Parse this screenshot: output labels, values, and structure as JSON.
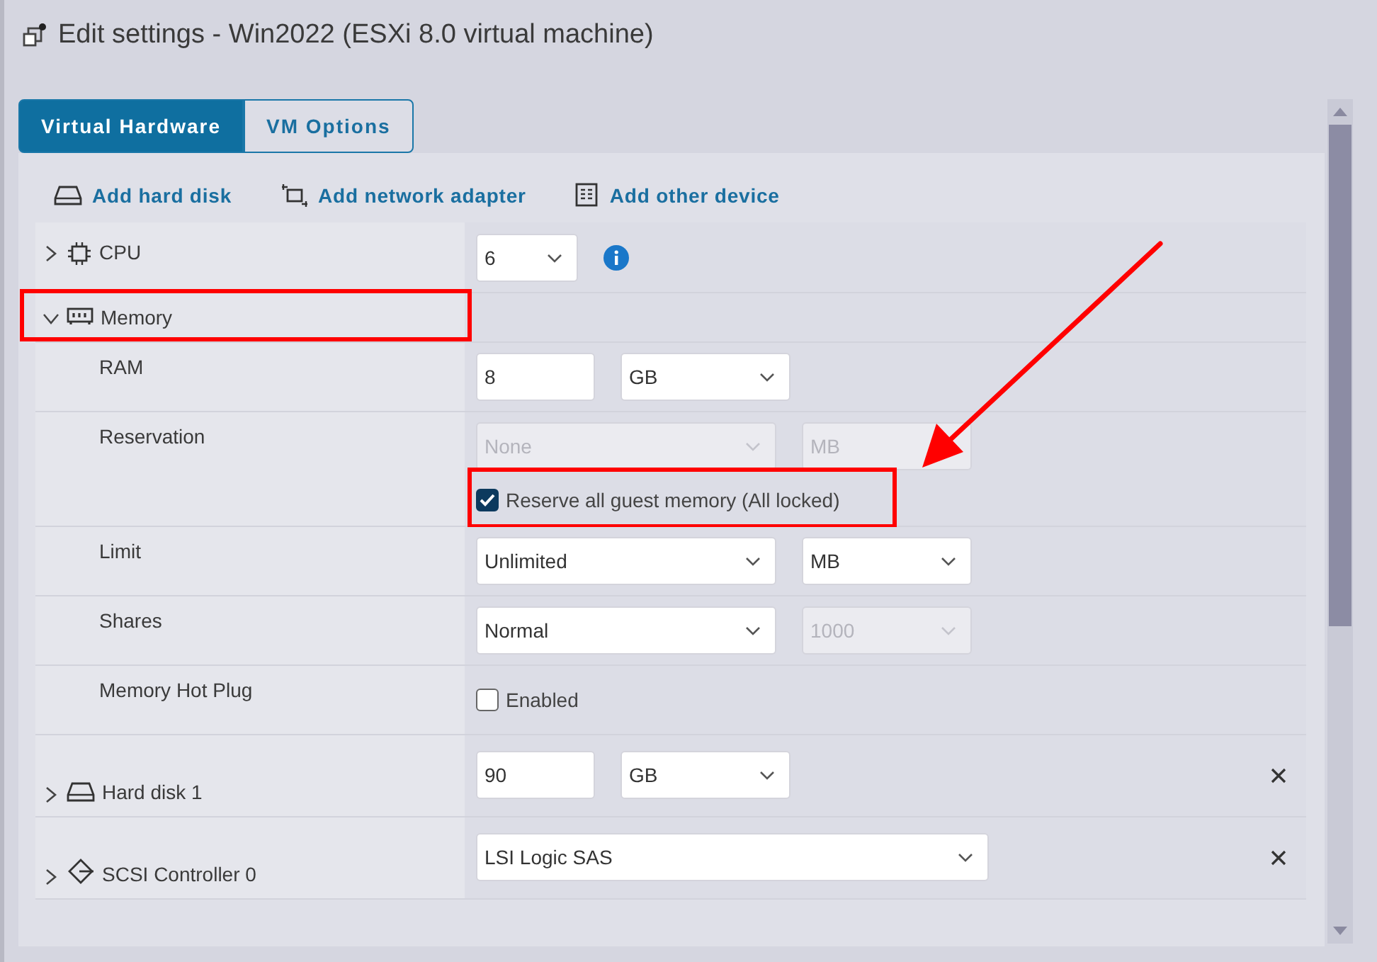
{
  "window": {
    "title": "Edit settings - Win2022 (ESXi 8.0 virtual machine)"
  },
  "tabs": [
    {
      "label": "Virtual Hardware",
      "selected": true
    },
    {
      "label": "VM Options",
      "selected": false
    }
  ],
  "toolbar": [
    {
      "kind": "disk",
      "label": "Add hard disk"
    },
    {
      "kind": "network",
      "label": "Add network adapter"
    },
    {
      "kind": "device",
      "label": "Add other device"
    }
  ],
  "rows": [
    {
      "kind": "cpu",
      "label": "CPU",
      "expanded": false,
      "highlighted": false,
      "removable": false,
      "controls": [
        {
          "kind": "select",
          "value": "6",
          "disabled": false
        },
        {
          "kind": "info"
        }
      ]
    },
    {
      "kind": "memory",
      "label": "Memory",
      "expanded": true,
      "highlighted": true,
      "removable": false,
      "controls": []
    },
    {
      "kind": "setting",
      "label": "RAM",
      "controls": [
        {
          "kind": "input",
          "value": "8",
          "disabled": false
        },
        {
          "kind": "select",
          "value": "GB",
          "disabled": false
        }
      ]
    },
    {
      "kind": "setting",
      "label": "Reservation",
      "controls": [
        {
          "kind": "select",
          "value": "None",
          "disabled": true
        },
        {
          "kind": "select",
          "value": "MB",
          "disabled": true
        },
        {
          "kind": "checkbox",
          "label": "Reserve all guest memory (All locked)",
          "checked": true,
          "highlighted": true
        }
      ]
    },
    {
      "kind": "setting",
      "label": "Limit",
      "controls": [
        {
          "kind": "select",
          "value": "Unlimited",
          "disabled": false
        },
        {
          "kind": "select",
          "value": "MB",
          "disabled": false
        }
      ]
    },
    {
      "kind": "setting",
      "label": "Shares",
      "controls": [
        {
          "kind": "select",
          "value": "Normal",
          "disabled": false
        },
        {
          "kind": "select",
          "value": "1000",
          "disabled": true
        }
      ]
    },
    {
      "kind": "setting",
      "label": "Memory Hot Plug",
      "controls": [
        {
          "kind": "checkbox",
          "label": "Enabled",
          "checked": false,
          "highlighted": false
        }
      ]
    },
    {
      "kind": "disk",
      "label": "Hard disk 1",
      "expanded": false,
      "highlighted": false,
      "removable": true,
      "controls": [
        {
          "kind": "input",
          "value": "90",
          "disabled": false
        },
        {
          "kind": "select",
          "value": "GB",
          "disabled": false
        }
      ]
    },
    {
      "kind": "controller",
      "label": "SCSI Controller 0",
      "expanded": false,
      "highlighted": false,
      "removable": true,
      "controls": [
        {
          "kind": "select",
          "value": "LSI Logic SAS",
          "disabled": false
        }
      ]
    }
  ],
  "annotation_arrow": true
}
